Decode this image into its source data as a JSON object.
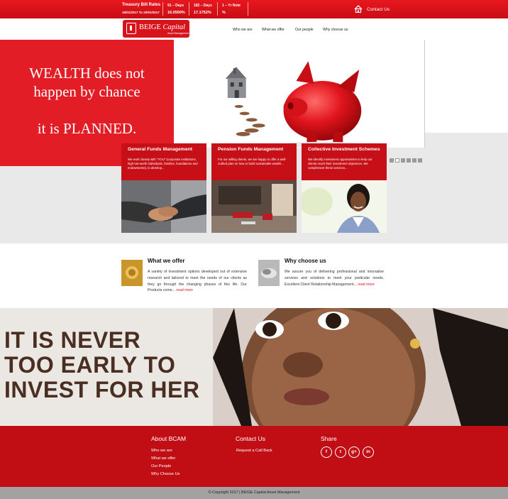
{
  "topbar": {
    "rates_title": "Treasury Bill Rates",
    "rates_dates": "16/01/2017 To 20/01/2017",
    "cols": [
      {
        "head": "91 – Days",
        "value": "16.0500%"
      },
      {
        "head": "182 – Days",
        "value": "17.1752%"
      },
      {
        "head": "1 – Yr Note",
        "value": "%"
      }
    ],
    "contact_label": "Contact Us",
    "contact_icon": "home-icon"
  },
  "logo": {
    "name": "BEIGE",
    "italic": "Capital",
    "sub": "Asset Management"
  },
  "nav": [
    "Who we are",
    "What we offer",
    "Our people",
    "Why choose us"
  ],
  "hero": {
    "line1": "WEALTH does not",
    "line2": "happen by chance",
    "line3": "it is PLANNED."
  },
  "cards": [
    {
      "title": "General Funds Management",
      "desc": "We work closely with \"YOU\" (corporate institutions, high-net-worth individuals, families, foundations and endowments), to develop..."
    },
    {
      "title": "Pension Funds Management",
      "desc": "For our willing clients, we are happy to offer a well-crafted plan on how to build sustainable wealth..."
    },
    {
      "title": "Collective Investment Schemes",
      "desc": "We identify investment opportunities to help our clients reach their investment objectives. We complement these services..."
    }
  ],
  "offer": {
    "title": "What we offer",
    "text": "A variety of investment options developed out of extensive research and tailored to meet the needs of our clients as they go through the changing phases of this life. Our Products come...",
    "more": "read more"
  },
  "why": {
    "title": "Why choose us",
    "text": "We assure you of delivering professional and innovative services and solutions to meet your particular needs. Excellent Client Relationship Management...",
    "more": "read more"
  },
  "banner": {
    "line1": "IT IS NEVER",
    "line2": "TOO EARLY TO",
    "line3": "INVEST FOR HER"
  },
  "footer": {
    "about_title": "About BCAM",
    "about_links": [
      "Who we are",
      "What we offer",
      "Our People",
      "Why Choose Us"
    ],
    "contact_title": "Contact Us",
    "contact_links": [
      "Request a Call Back"
    ],
    "share_title": "Share",
    "social": [
      {
        "icon": "facebook-icon",
        "glyph": "f"
      },
      {
        "icon": "twitter-icon",
        "glyph": "t"
      },
      {
        "icon": "google-plus-icon",
        "glyph": "g+"
      },
      {
        "icon": "linkedin-icon",
        "glyph": "in"
      }
    ],
    "copyright": "© Copyright 2017 | BEIGE Capital Asset Management"
  },
  "colors": {
    "brand_red": "#d7141c",
    "dark_red": "#c10e15",
    "footer_grey": "#a2a2a2"
  }
}
